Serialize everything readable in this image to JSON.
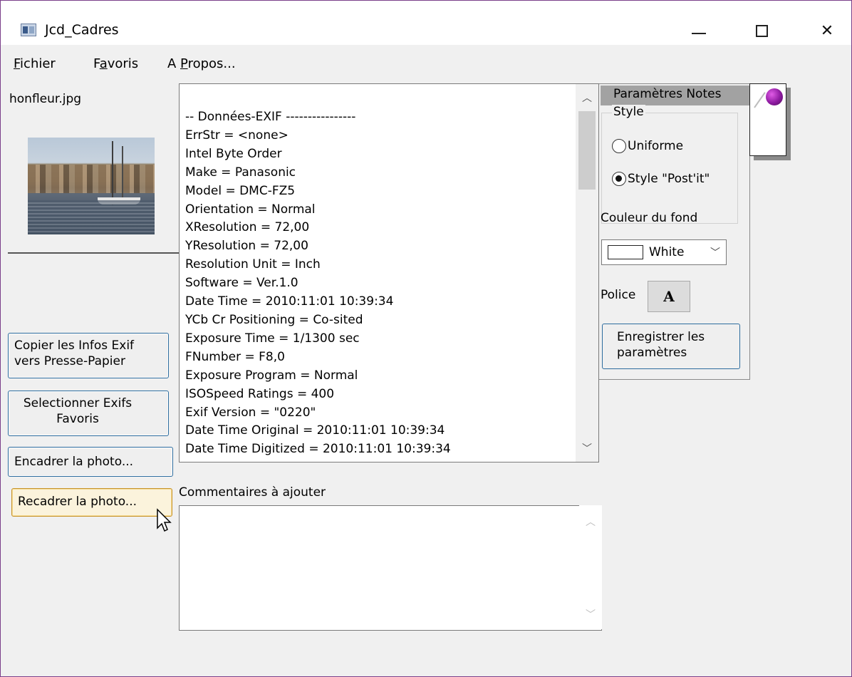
{
  "window": {
    "title": "Jcd_Cadres",
    "controls": {
      "minimize": "minimize-icon",
      "maximize": "maximize-icon",
      "close": "close-icon",
      "close_glyph": "✕"
    }
  },
  "menu": {
    "items": [
      {
        "first": "F",
        "rest": "ichier"
      },
      {
        "first": "F",
        "underlined": "a",
        "rest": "voris"
      },
      {
        "first": "A ",
        "underlined": "P",
        "rest": "ropos..."
      }
    ]
  },
  "image": {
    "filename": "honfleur.jpg",
    "thumbnail_icon": "harbor-photo"
  },
  "left_buttons": {
    "copy_exif": "Copier les Infos Exif vers Presse-Papier",
    "select_exif": "Selectionner Exifs Favoris",
    "frame_photo": "Encadrer la photo...",
    "crop_photo": "Recadrer la photo..."
  },
  "exif": {
    "lines": [
      "-- Données-EXIF ----------------",
      "ErrStr = <none>",
      "Intel Byte Order",
      "Make = Panasonic",
      "Model = DMC-FZ5",
      "Orientation = Normal",
      "XResolution = 72,00",
      "YResolution = 72,00",
      "Resolution Unit = Inch",
      "Software = Ver.1.0",
      "Date Time = 2010:11:01 10:39:34",
      "YCb Cr Positioning = Co-sited",
      "Exposure Time = 1/1300 sec",
      "FNumber = F8,0",
      "Exposure Program = Normal",
      "ISOSpeed Ratings = 400",
      "Exif Version = \"0220\"",
      "Date Time Original = 2010:11:01 10:39:34",
      "Date Time Digitized = 2010:11:01 10:39:34"
    ]
  },
  "comments": {
    "label": "Commentaires à ajouter",
    "value": ""
  },
  "notes_panel": {
    "header": "Paramètres Notes",
    "style_legend": "Style",
    "radio_uniforme": "Uniforme",
    "radio_postit": "Style \"Post'it\"",
    "selected_style": "Style \"Post'it\"",
    "bg_label": "Couleur du fond",
    "bg_color_value": "White",
    "police_label": "Police",
    "police_button": "A",
    "save_button": "Enregistrer les paramètres"
  },
  "colors": {
    "window_border": "#7a3f8a",
    "button_border": "#2d6c9e",
    "hover_button_bg": "#fbf3dc",
    "pin": "#8d1aa0"
  }
}
